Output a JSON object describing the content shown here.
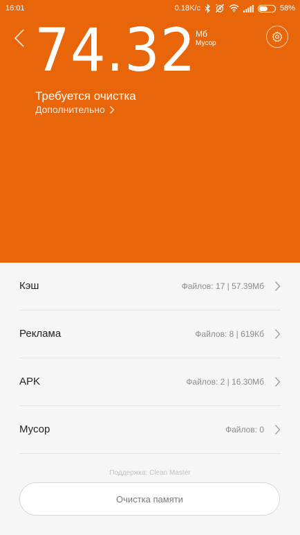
{
  "colors": {
    "accent": "#e8650a",
    "list_bg": "#f6f6f6"
  },
  "status_bar": {
    "time": "16:01",
    "speed": "0.18K/c",
    "battery_text": "58%",
    "battery_level": 0.58,
    "icons": [
      "bluetooth-icon",
      "alarm-off-icon",
      "wifi-icon",
      "signal-icon",
      "battery-icon"
    ]
  },
  "header": {
    "size_value": "74.32",
    "unit": "Мб",
    "unit_label": "Мусор",
    "status": "Требуется очистка",
    "more_link": "Дополнительно",
    "icons": [
      "back-arrow-icon",
      "gear-icon",
      "chevron-right-icon"
    ]
  },
  "categories": [
    {
      "label": "Кэш",
      "info": "Файлов: 17 | 57.39Мб"
    },
    {
      "label": "Реклама",
      "info": "Файлов: 8 | 619Кб"
    },
    {
      "label": "APK",
      "info": "Файлов: 2 | 16.30Мб"
    },
    {
      "label": "Мусор",
      "info": "Файлов: 0"
    }
  ],
  "footer": {
    "support": "Поддержка: Clean Master",
    "clean_button": "Очистка памяти"
  }
}
